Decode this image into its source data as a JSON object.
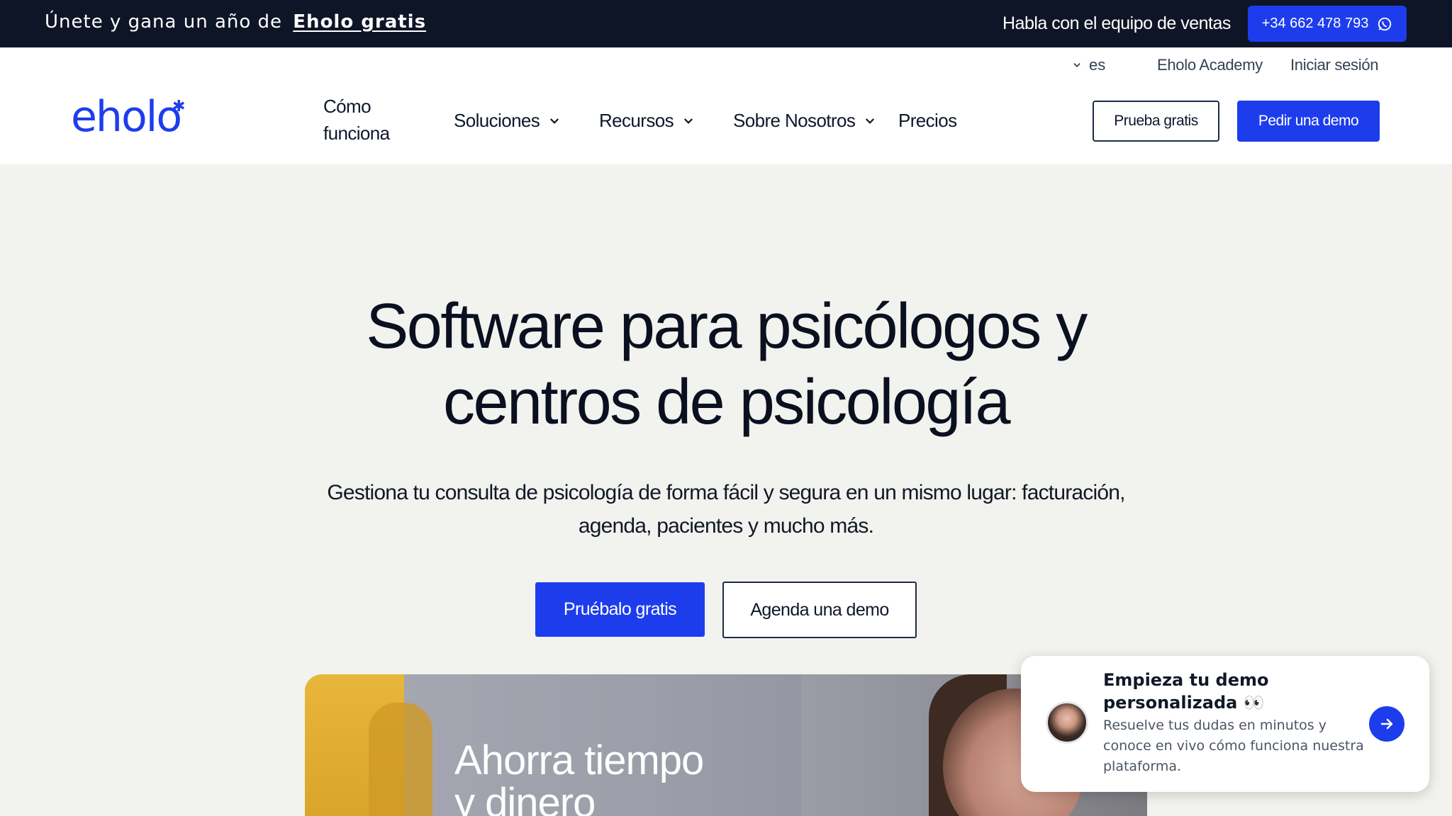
{
  "topbar": {
    "promo_text": "Únete y gana un año de",
    "promo_link": "Eholo gratis",
    "sales_text": "Habla con el equipo de ventas",
    "phone": "+34 662 478 793"
  },
  "header": {
    "language": "es",
    "academy": "Eholo Academy",
    "login": "Iniciar sesión",
    "logo": "eholo",
    "logo_mark": "✱",
    "nav": {
      "como_funciona": "Cómo funciona",
      "soluciones": "Soluciones",
      "recursos": "Recursos",
      "sobre_nosotros": "Sobre Nosotros",
      "precios": "Precios"
    },
    "trial_button": "Prueba gratis",
    "demo_button": "Pedir una demo"
  },
  "hero": {
    "title_line1": "Software para psicólogos y",
    "title_line2": "centros de psicología",
    "subtitle": "Gestiona tu consulta de psicología de forma fácil y segura en un mismo lugar: facturación, agenda, pacientes y mucho más.",
    "cta_primary": "Pruébalo gratis",
    "cta_secondary": "Agenda una demo",
    "media_text_line1": "Ahorra tiempo",
    "media_text_line2": "y dinero"
  },
  "chat": {
    "title": "Empieza tu demo personalizada 👀",
    "body": "Resuelve tus dudas en minutos y conoce en vivo cómo funciona nuestra plataforma."
  },
  "colors": {
    "brand_blue": "#1d3ded",
    "topbar_bg": "#0e1526",
    "page_bg": "#f2f2ee"
  },
  "icons": [
    "whatsapp-icon",
    "chevron-down-icon",
    "arrow-right-icon"
  ]
}
